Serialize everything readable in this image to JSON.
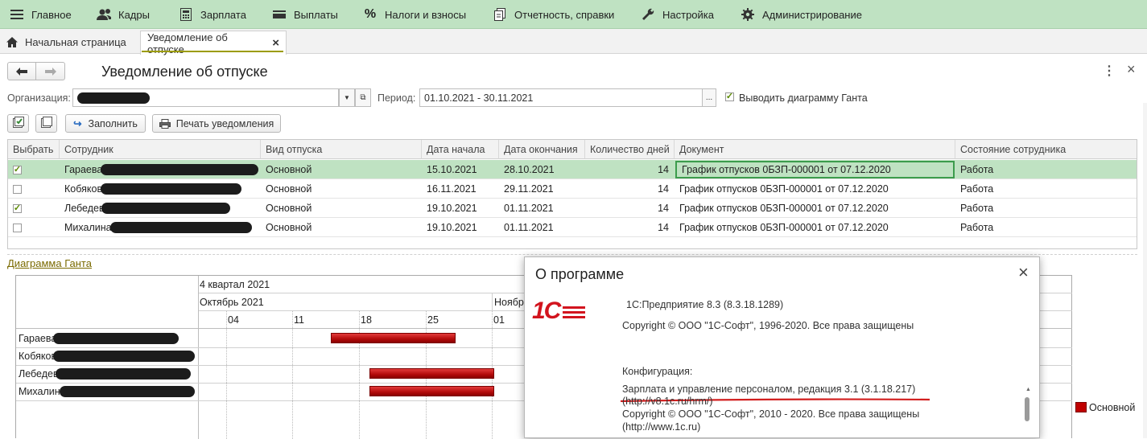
{
  "menu": [
    {
      "label": "Главное",
      "icon": "hamburger-icon"
    },
    {
      "label": "Кадры",
      "icon": "people-icon"
    },
    {
      "label": "Зарплата",
      "icon": "calculator-icon"
    },
    {
      "label": "Выплаты",
      "icon": "wallet-icon"
    },
    {
      "label": "Налоги и взносы",
      "icon": "percent-icon"
    },
    {
      "label": "Отчетность, справки",
      "icon": "documents-icon"
    },
    {
      "label": "Настройка",
      "icon": "wrench-icon"
    },
    {
      "label": "Администрирование",
      "icon": "gear-icon"
    }
  ],
  "tabs": {
    "home": "Начальная страница",
    "active": "Уведомление об отпуске",
    "close": "×"
  },
  "form": {
    "title": "Уведомление об отпуске",
    "org_label": "Организация:",
    "period_label": "Период:",
    "period_value": "01.10.2021 - 30.11.2021",
    "period_btn": "...",
    "gantt_checkbox_label": "Выводить диаграмму Ганта",
    "gantt_checked": true,
    "fill_button": "Заполнить",
    "print_button": "Печать уведомления",
    "more": "⋮",
    "close": "×"
  },
  "table": {
    "columns": [
      "Выбрать",
      "Сотрудник",
      "Вид отпуска",
      "Дата начала",
      "Дата окончания",
      "Количество дней",
      "Документ",
      "Состояние сотрудника"
    ],
    "rows": [
      {
        "checked": true,
        "employee": "Гараева",
        "type": "Основной",
        "start": "15.10.2021",
        "end": "28.10.2021",
        "days": "14",
        "doc": "График отпусков 0БЗП-000001 от 07.12.2020",
        "state": "Работа"
      },
      {
        "checked": false,
        "employee": "Кобяков",
        "type": "Основной",
        "start": "16.11.2021",
        "end": "29.11.2021",
        "days": "14",
        "doc": "График отпусков 0БЗП-000001 от 07.12.2020",
        "state": "Работа"
      },
      {
        "checked": true,
        "employee": "Лебедев",
        "type": "Основной",
        "start": "19.10.2021",
        "end": "01.11.2021",
        "days": "14",
        "doc": "График отпусков 0БЗП-000001 от 07.12.2020",
        "state": "Работа"
      },
      {
        "checked": false,
        "employee": "Михалина",
        "type": "Основной",
        "start": "19.10.2021",
        "end": "01.11.2021",
        "days": "14",
        "doc": "График отпусков 0БЗП-000001 от 07.12.2020",
        "state": "Работа"
      }
    ]
  },
  "gantt": {
    "link": "Диаграмма Ганта",
    "quarter": "4 квартал 2021",
    "month1": "Октябрь 2021",
    "month2": "Ноябр",
    "days": [
      "04",
      "11",
      "18",
      "25",
      "01"
    ],
    "rows": [
      "Гараева",
      "Кобяков",
      "Лебедев",
      "Михалина"
    ],
    "legend": "Основной",
    "bar_color": "#c00000"
  },
  "about": {
    "title": "О программе",
    "close": "×",
    "logo": "1С",
    "platform": "1С:Предприятие 8.3 (8.3.18.1289)",
    "copyright1": "Copyright © ООО \"1С-Софт\", 1996-2020. Все права защищены",
    "config_label": "Конфигурация:",
    "config_name": "Зарплата и управление персоналом, редакция 3.1 (3.1.18.217)",
    "config_url": "(http://v8.1c.ru/hrm/)",
    "copyright2": "Copyright © ООО \"1С-Софт\", 2010 - 2020. Все права защищены",
    "site": "(http://www.1c.ru)"
  },
  "colors": {
    "menubar": "#bfe2c2",
    "selected_row": "#bfe2c2",
    "accent_underline": "#d21f1f",
    "link": "#7a6a00"
  }
}
